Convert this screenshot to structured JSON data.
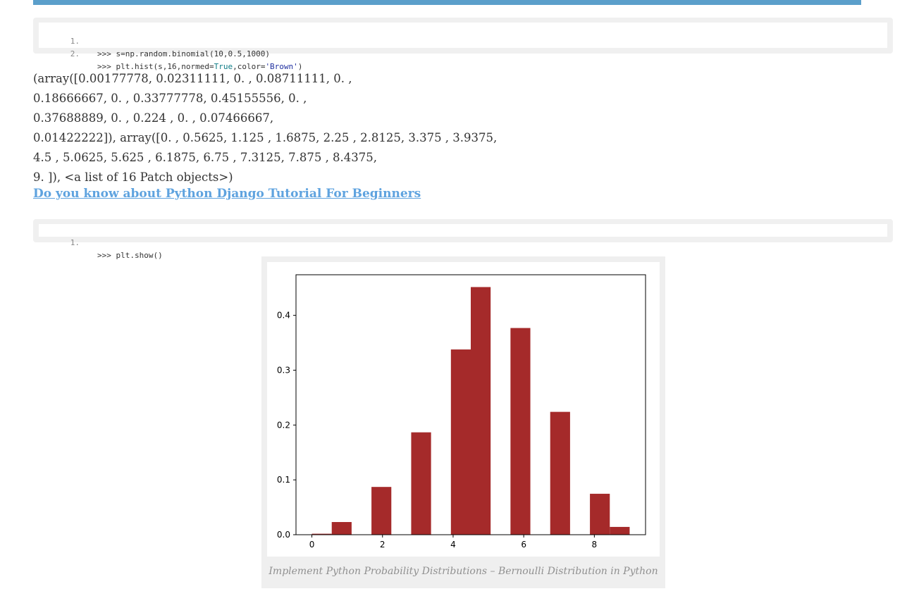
{
  "code_block_1": {
    "lines": [
      {
        "num": "1.",
        "prompt": ">>> ",
        "text": "s=np.random.binomial(10,0.5,1000)"
      },
      {
        "num": "2.",
        "prompt": ">>> ",
        "pre": "plt.hist(s,16,normed=",
        "kw": "True",
        "mid": ",color=",
        "str": "'Brown'",
        "post": ")"
      }
    ]
  },
  "output_lines": [
    "(array([0.00177778, 0.02311111, 0. , 0.08711111, 0. ,",
    "0.18666667, 0. , 0.33777778, 0.45155556, 0. ,",
    "0.37688889, 0. , 0.224 , 0. , 0.07466667,",
    "0.01422222]), array([0. , 0.5625, 1.125 , 1.6875, 2.25 , 2.8125, 3.375 , 3.9375,",
    "4.5 , 5.0625, 5.625 , 6.1875, 6.75 , 7.3125, 7.875 , 8.4375,",
    "9. ]), <a list of 16 Patch objects>)"
  ],
  "link_text": "Do you know about Python Django Tutorial For Beginners",
  "code_block_2": {
    "lines": [
      {
        "num": "1.",
        "prompt": ">>> ",
        "text": "plt.show()"
      }
    ]
  },
  "figure_caption": "Implement Python Probability Distributions – Bernoulli Distribution in Python",
  "colors": {
    "bar": "#a52a2a",
    "accent": "#5b9fcb",
    "link": "#5fa3df"
  },
  "chart_data": {
    "type": "bar",
    "bin_edges": [
      0,
      0.5625,
      1.125,
      1.6875,
      2.25,
      2.8125,
      3.375,
      3.9375,
      4.5,
      5.0625,
      5.625,
      6.1875,
      6.75,
      7.3125,
      7.875,
      8.4375,
      9
    ],
    "values": [
      0.00177778,
      0.02311111,
      0,
      0.08711111,
      0,
      0.18666667,
      0,
      0.33777778,
      0.45155556,
      0,
      0.37688889,
      0,
      0.224,
      0,
      0.07466667,
      0.01422222
    ],
    "xticks": [
      0,
      2,
      4,
      6,
      8
    ],
    "yticks": [
      0.0,
      0.1,
      0.2,
      0.3,
      0.4
    ],
    "xlim": [
      -0.45,
      9.45
    ],
    "ylim": [
      0,
      0.474
    ]
  }
}
